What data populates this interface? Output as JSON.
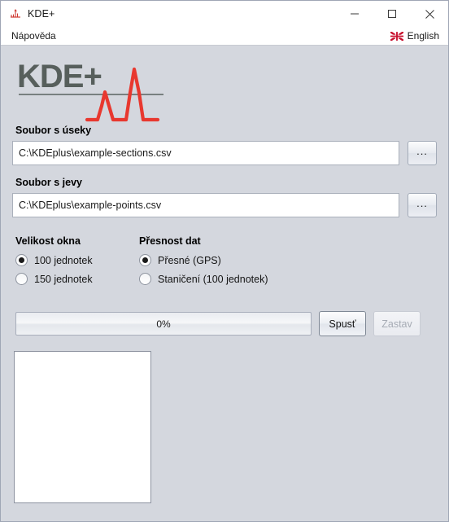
{
  "window": {
    "title": "KDE+",
    "app_icon": "kde-plus-chart-icon",
    "controls": {
      "minimize": "minimize-icon",
      "maximize": "maximize-icon",
      "close": "close-icon"
    }
  },
  "menubar": {
    "help_label": "Nápověda",
    "language": {
      "flag": "uk-flag-icon",
      "label": "English"
    }
  },
  "logo": {
    "text": "KDE+",
    "text_color": "#575f5c",
    "curve_color": "#e8382f",
    "rule_color": "#5a6360"
  },
  "sections_file": {
    "label": "Soubor s úseky",
    "value": "C:\\KDEplus\\example-sections.csv",
    "placeholder": "",
    "browse_label": "..."
  },
  "points_file": {
    "label": "Soubor s jevy",
    "value": "C:\\KDEplus\\example-points.csv",
    "placeholder": "",
    "browse_label": "..."
  },
  "window_size_group": {
    "title": "Velikost okna",
    "options": [
      {
        "label": "100 jednotek",
        "selected": true
      },
      {
        "label": "150 jednotek",
        "selected": false
      }
    ]
  },
  "data_precision_group": {
    "title": "Přesnost dat",
    "options": [
      {
        "label": "Přesné (GPS)",
        "selected": true
      },
      {
        "label": "Staničení (100 jednotek)",
        "selected": false
      }
    ]
  },
  "progress": {
    "text": "0%",
    "percent": 0
  },
  "buttons": {
    "start": "Spusť",
    "stop": "Zastav",
    "stop_disabled": true
  },
  "log": {
    "value": "",
    "placeholder": ""
  }
}
